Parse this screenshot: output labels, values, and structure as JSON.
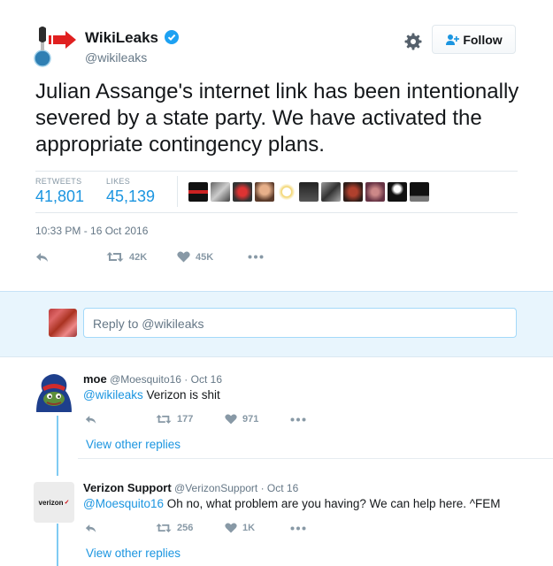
{
  "tweet": {
    "author_name": "WikiLeaks",
    "author_handle": "@wikileaks",
    "follow_label": "Follow",
    "text": "Julian Assange's internet link has been intentionally severed by a state party. We have activated the appropriate contingency plans.",
    "retweets_label": "RETWEETS",
    "retweets_value": "41,801",
    "likes_label": "LIKES",
    "likes_value": "45,139",
    "timestamp": "10:33 PM - 16 Oct 2016",
    "action_retweet_count": "42K",
    "action_like_count": "45K"
  },
  "reply_box": {
    "placeholder": "Reply to @wikileaks"
  },
  "replies": [
    {
      "name": "moe",
      "meta": "@Moesquito16 · Oct 16",
      "mention": "@wikileaks",
      "text": " Verizon is shit",
      "retweets": "177",
      "likes": "971",
      "view_replies": "View other replies"
    },
    {
      "name": "Verizon Support",
      "meta": "@VerizonSupport · Oct 16",
      "mention": "@Moesquito16",
      "text": " Oh no, what problem are you having? We can help here. ^FEM",
      "retweets": "256",
      "likes": "1K",
      "view_replies": "View other replies",
      "avatar_text": "verizon"
    }
  ],
  "icons": {
    "verified": "verified-badge-icon",
    "gear": "gear-icon",
    "follow": "add-user-icon",
    "reply": "reply-icon",
    "retweet": "retweet-icon",
    "like": "heart-icon",
    "more": "more-dots-icon"
  },
  "colors": {
    "accent": "#1b95e0",
    "reply_band": "#e8f5fd",
    "thread_line": "#80cbf3"
  }
}
